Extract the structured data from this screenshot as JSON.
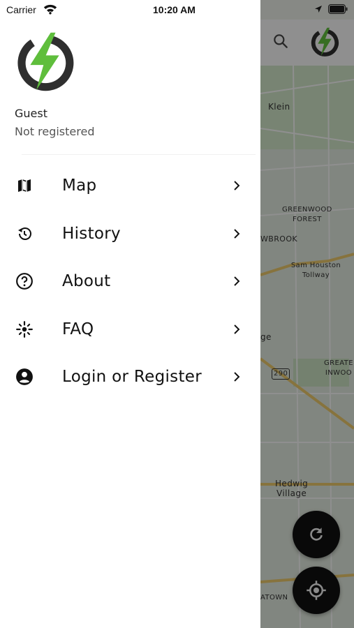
{
  "status_bar": {
    "carrier": "Carrier",
    "time": "10:20 AM"
  },
  "drawer": {
    "user": {
      "name": "Guest",
      "status": "Not registered"
    },
    "menu": [
      {
        "label": "Map",
        "icon": "map-icon"
      },
      {
        "label": "History",
        "icon": "history-icon"
      },
      {
        "label": "About",
        "icon": "help-circle-icon"
      },
      {
        "label": "FAQ",
        "icon": "sparkle-icon"
      },
      {
        "label": "Login or Register",
        "icon": "account-circle-icon"
      }
    ]
  },
  "map": {
    "labels": [
      "Klein",
      "GREENWOOD\nFOREST",
      "WBROOK",
      "Sam Houston Tollway",
      "ge",
      "290",
      "GREATE\nINWOO",
      "Hedwig\nVillage",
      "ATOWN"
    ]
  },
  "colors": {
    "accent_green": "#5fbe3c",
    "logo_dark": "#2f2f2f",
    "fab": "#111111"
  }
}
